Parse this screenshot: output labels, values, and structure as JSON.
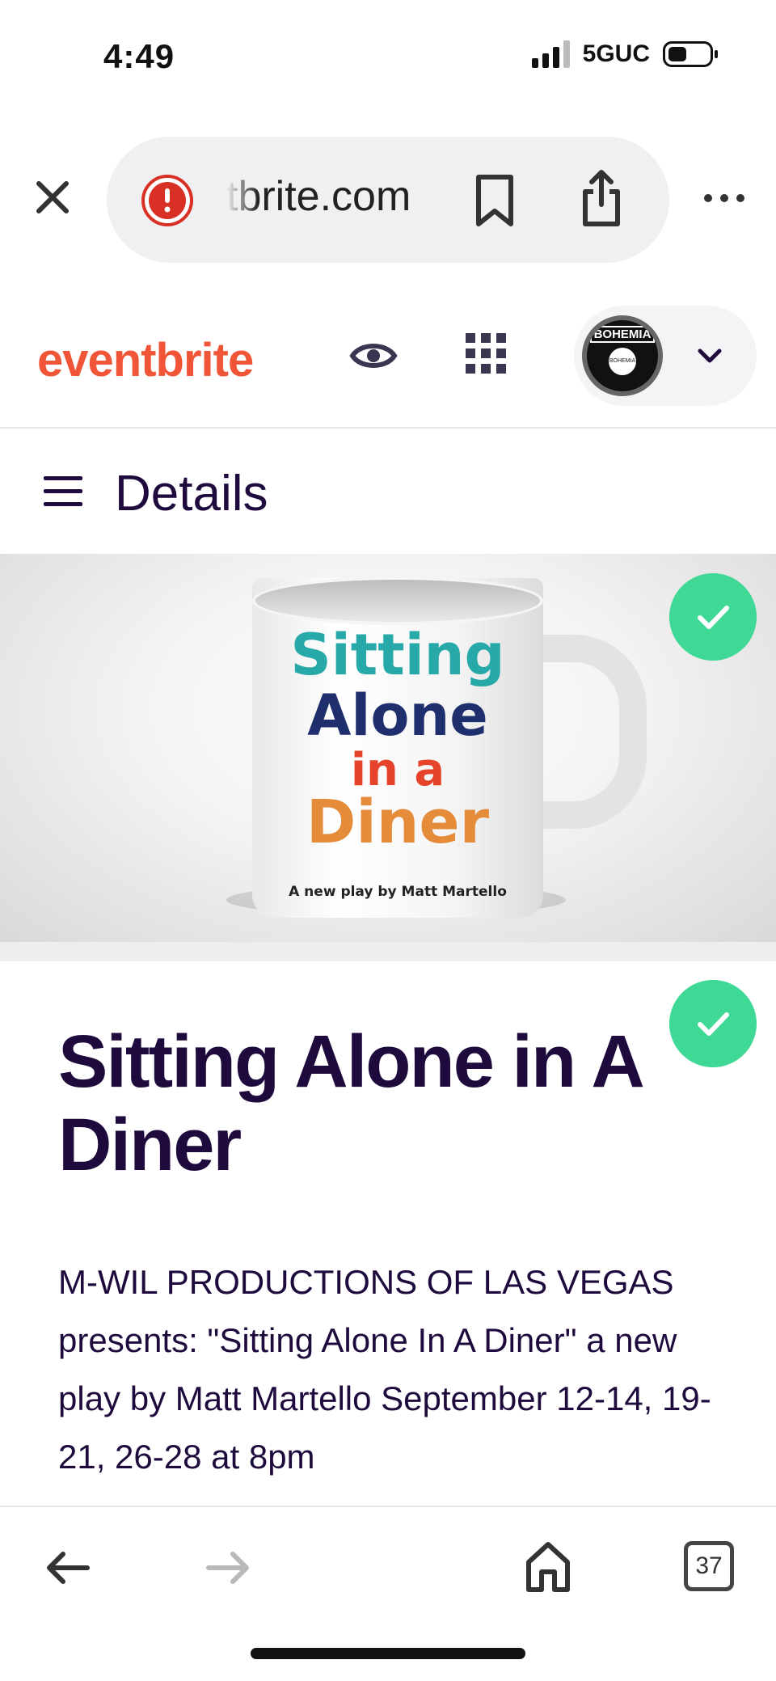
{
  "status_bar": {
    "time": "4:49",
    "network": "5GUC"
  },
  "browser": {
    "url": "tbrite.com",
    "open_tabs": "37"
  },
  "eventbrite": {
    "logo": "eventbrite",
    "avatar_text": "BOHEMIA",
    "avatar_inner": "BOHEMIA"
  },
  "details": {
    "title": "Details"
  },
  "hero": {
    "mug_line_1": "Sitting",
    "mug_line_2": "Alone",
    "mug_line_3": "in a",
    "mug_line_4": "Diner",
    "mug_byline": "A new play by Matt Martello"
  },
  "event": {
    "title": "Sitting Alone in A Diner",
    "summary": "M-WIL PRODUCTIONS OF LAS VEGAS presents: \"Sitting Alone In A Diner\" a new play by Matt Martello September 12-14, 19-21, 26-28 at 8pm"
  },
  "colors": {
    "brand": "#f05537",
    "text": "#1e0a3c",
    "check": "#3fd995"
  }
}
